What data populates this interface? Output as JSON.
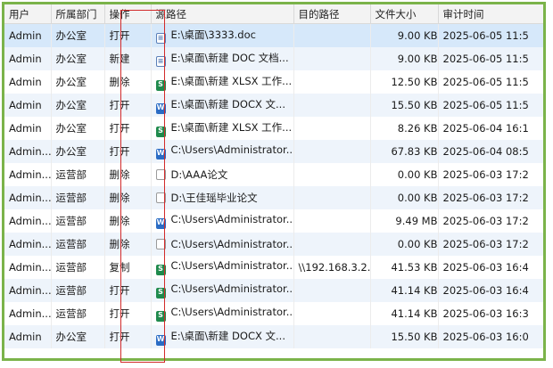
{
  "columns": [
    "用户",
    "所属部门",
    "操作",
    "源路径",
    "目的路径",
    "文件大小",
    "审计时间"
  ],
  "rows": [
    {
      "user": "Admin",
      "dept": "办公室",
      "op": "打开",
      "icon": "doc-file-icon",
      "src": "E:\\桌面\\3333.doc",
      "dst": "",
      "size": "9.00 KB",
      "time": "2025-06-05 11:5"
    },
    {
      "user": "Admin",
      "dept": "办公室",
      "op": "新建",
      "icon": "doc-file-icon",
      "src": "E:\\桌面\\新建 DOC 文档...",
      "dst": "",
      "size": "9.00 KB",
      "time": "2025-06-05 11:5"
    },
    {
      "user": "Admin",
      "dept": "办公室",
      "op": "删除",
      "icon": "excel-file-icon",
      "src": "E:\\桌面\\新建 XLSX 工作...",
      "dst": "",
      "size": "12.50 KB",
      "time": "2025-06-05 11:5"
    },
    {
      "user": "Admin",
      "dept": "办公室",
      "op": "打开",
      "icon": "word-file-icon",
      "src": "E:\\桌面\\新建 DOCX 文...",
      "dst": "",
      "size": "15.50 KB",
      "time": "2025-06-05 11:5"
    },
    {
      "user": "Admin",
      "dept": "办公室",
      "op": "打开",
      "icon": "excel-file-icon",
      "src": "E:\\桌面\\新建 XLSX 工作...",
      "dst": "",
      "size": "8.26 KB",
      "time": "2025-06-04 16:1"
    },
    {
      "user": "Admin...",
      "dept": "办公室",
      "op": "打开",
      "icon": "word-file-icon",
      "src": "C:\\Users\\Administrator...",
      "dst": "",
      "size": "67.83 KB",
      "time": "2025-06-04 08:5"
    },
    {
      "user": "Admin...",
      "dept": "运营部",
      "op": "删除",
      "icon": "blank-file-icon",
      "src": "D:\\AAA论文",
      "dst": "",
      "size": "0.00 KB",
      "time": "2025-06-03 17:2"
    },
    {
      "user": "Admin...",
      "dept": "运营部",
      "op": "删除",
      "icon": "blank-file-icon",
      "src": "D:\\王佳瑶毕业论文",
      "dst": "",
      "size": "0.00 KB",
      "time": "2025-06-03 17:2"
    },
    {
      "user": "Admin...",
      "dept": "运营部",
      "op": "删除",
      "icon": "word-file-icon",
      "src": "C:\\Users\\Administrator...",
      "dst": "",
      "size": "9.49 MB",
      "time": "2025-06-03 17:2"
    },
    {
      "user": "Admin...",
      "dept": "运营部",
      "op": "删除",
      "icon": "blank-file-icon",
      "src": "C:\\Users\\Administrator...",
      "dst": "",
      "size": "0.00 KB",
      "time": "2025-06-03 17:2"
    },
    {
      "user": "Admin...",
      "dept": "运营部",
      "op": "复制",
      "icon": "excel-file-icon",
      "src": "C:\\Users\\Administrator...",
      "dst": "\\\\192.168.3.2...",
      "size": "41.53 KB",
      "time": "2025-06-03 16:4"
    },
    {
      "user": "Admin...",
      "dept": "运营部",
      "op": "打开",
      "icon": "excel-file-icon",
      "src": "C:\\Users\\Administrator...",
      "dst": "",
      "size": "41.14 KB",
      "time": "2025-06-03 16:4"
    },
    {
      "user": "Admin...",
      "dept": "运营部",
      "op": "打开",
      "icon": "excel-file-icon",
      "src": "C:\\Users\\Administrator...",
      "dst": "",
      "size": "41.14 KB",
      "time": "2025-06-03 16:3"
    },
    {
      "user": "Admin",
      "dept": "办公室",
      "op": "打开",
      "icon": "word-file-icon",
      "src": "E:\\桌面\\新建 DOCX 文...",
      "dst": "",
      "size": "15.50 KB",
      "time": "2025-06-03 16:0"
    }
  ],
  "icons": {
    "doc-file-icon": {
      "glyph": "≡",
      "cls": "ic-doc"
    },
    "word-file-icon": {
      "glyph": "W",
      "cls": "ic-word"
    },
    "excel-file-icon": {
      "glyph": "S",
      "cls": "ic-xls"
    },
    "blank-file-icon": {
      "glyph": "",
      "cls": "ic-blank"
    }
  },
  "colors": {
    "frame": "#7bb34a",
    "highlight": "#d22a2a",
    "selected_row": "#d6e8fa"
  }
}
